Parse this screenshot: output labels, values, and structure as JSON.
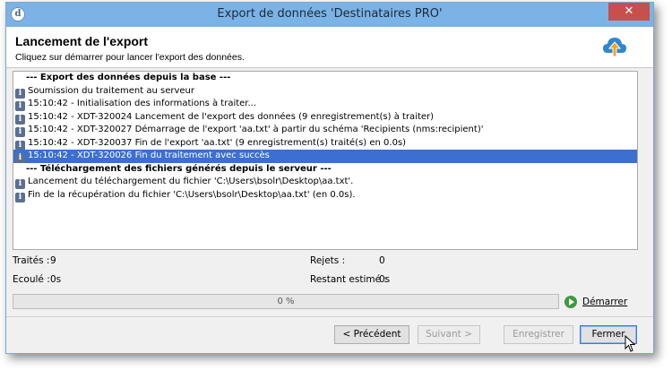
{
  "window": {
    "title": "Export de données 'Destinataires PRO'",
    "close_glyph": "✕",
    "app_icon_glyph": "d"
  },
  "header": {
    "title": "Lancement de l'export",
    "subtitle": "Cliquez sur démarrer pour lancer l'export des données."
  },
  "log": [
    {
      "kind": "head",
      "text": "--- Export des données depuis la base ---"
    },
    {
      "kind": "info",
      "text": "Soumission du traitement au serveur"
    },
    {
      "kind": "info",
      "text": "15:10:42 - Initialisation des informations à traiter..."
    },
    {
      "kind": "info",
      "text": "15:10:42 - XDT-320024 Lancement de l'export des données (9 enregistrement(s) à traiter)"
    },
    {
      "kind": "info",
      "text": "15:10:42 - XDT-320027 Démarrage de l'export 'aa.txt' à partir du schéma 'Recipients (nms:recipient)'"
    },
    {
      "kind": "info",
      "text": "15:10:42 - XDT-320037 Fin de l'export 'aa.txt' (9 enregistrement(s) traité(s) en 0.0s)"
    },
    {
      "kind": "info",
      "text": "15:10:42 - XDT-320026 Fin du traitement avec succès",
      "selected": true
    },
    {
      "kind": "head",
      "text": "--- Téléchargement des fichiers générés depuis le serveur ---"
    },
    {
      "kind": "info",
      "text": "Lancement du téléchargement du fichier 'C:\\Users\\bsolr\\Desktop\\aa.txt'."
    },
    {
      "kind": "info",
      "text": "Fin de la récupération du fichier 'C:\\Users\\bsolr\\Desktop\\aa.txt' (en 0.0s)."
    }
  ],
  "stats": {
    "processed_label": "Traités :",
    "processed_value": "9",
    "rejects_label": "Rejets :",
    "rejects_value": "0",
    "elapsed_label": "Ecoulé :",
    "elapsed_value": "0s",
    "remaining_label": "Restant estimé :",
    "remaining_value": "0s"
  },
  "progress": {
    "value": 0,
    "label": "0 %"
  },
  "start": {
    "label": "Démarrer"
  },
  "buttons": {
    "previous": "< Précédent",
    "next": "Suivant >",
    "save": "Enregistrer",
    "close": "Fermer"
  },
  "colors": {
    "titlebar": "#7cb3e6",
    "selection": "#3b6fd0",
    "close_button": "#c7504a",
    "start_icon": "#3c9a3c"
  }
}
